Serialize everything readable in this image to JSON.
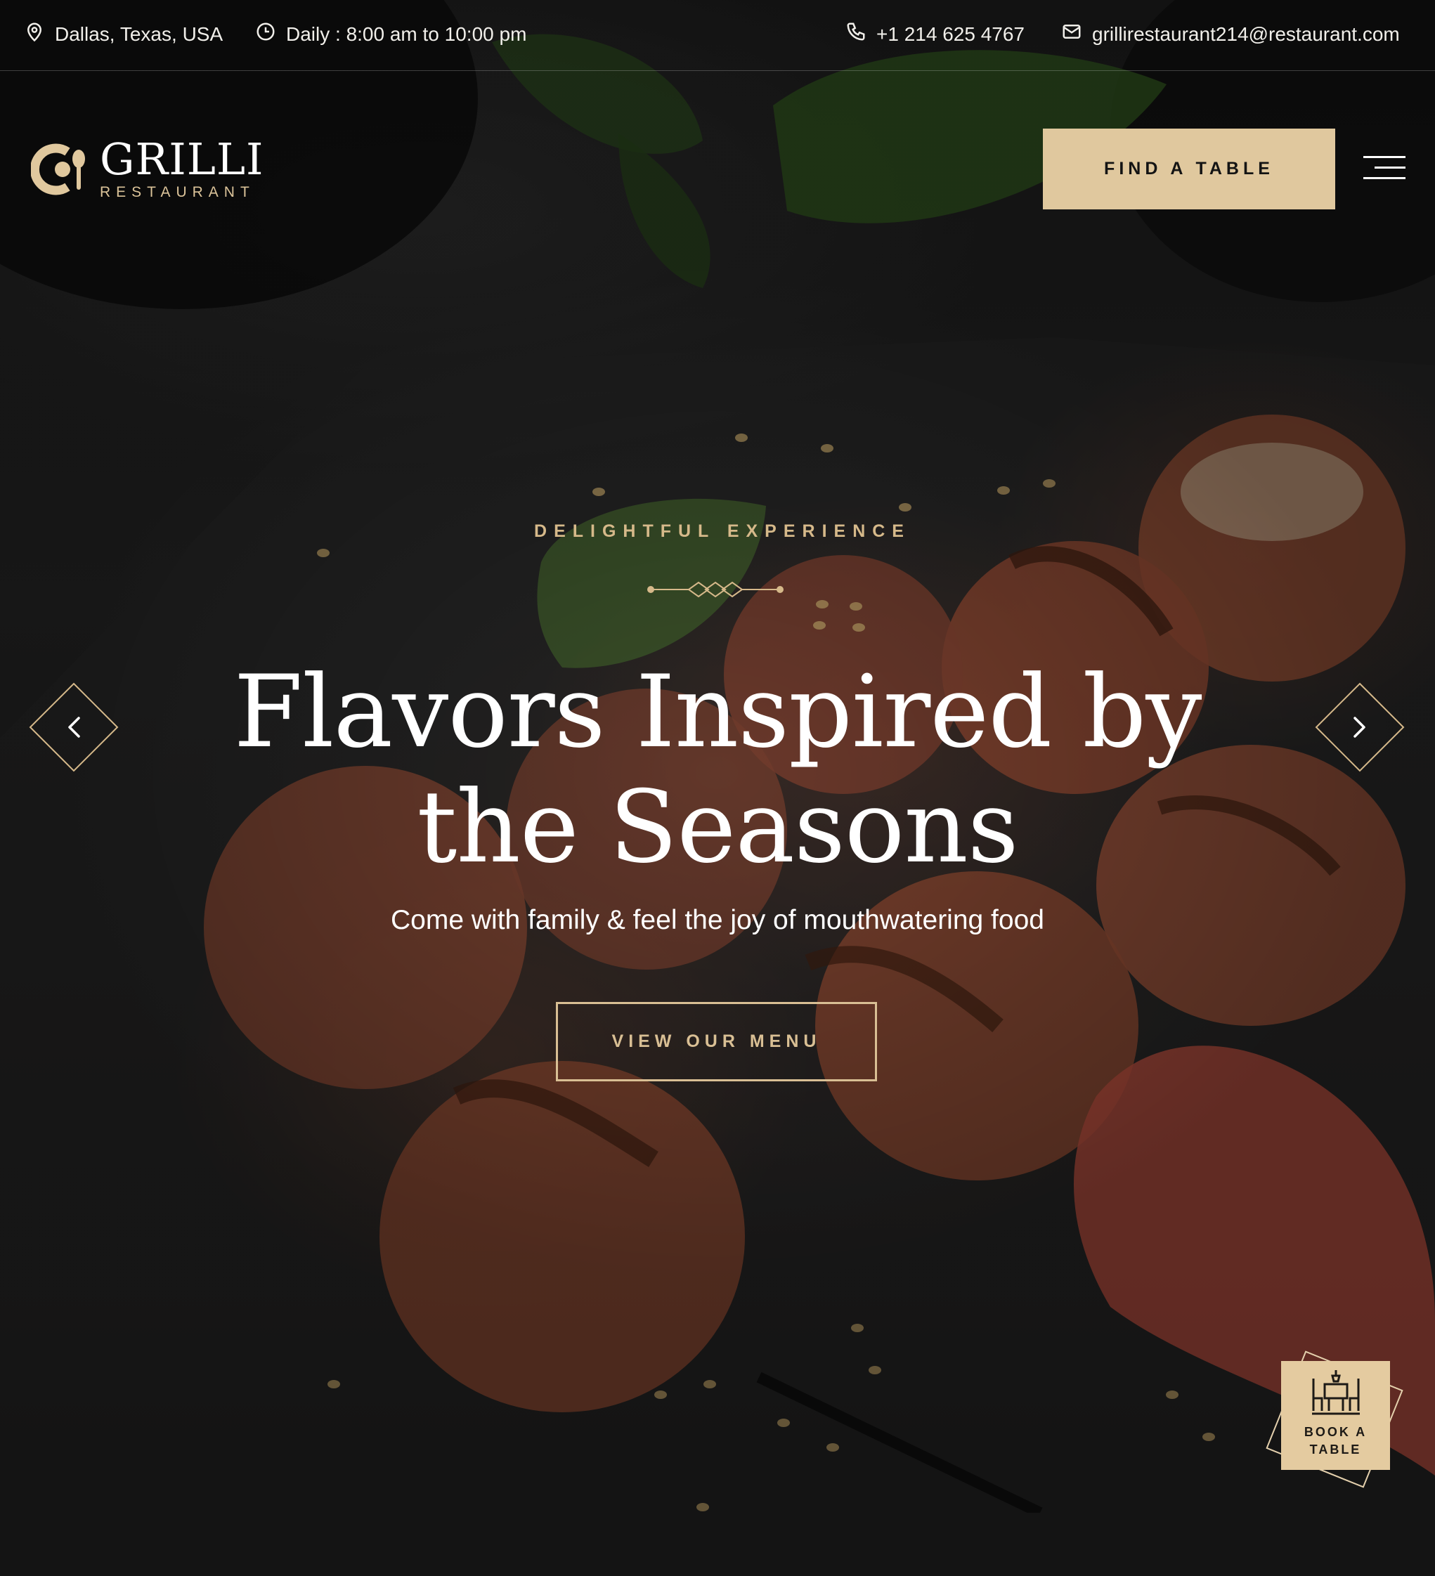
{
  "topbar": {
    "location": "Dallas, Texas, USA",
    "hours": "Daily : 8:00 am to 10:00 pm",
    "phone": "+1 214 625 4767",
    "email": "grillirestaurant214@restaurant.com",
    "icons": [
      "location-pin-icon",
      "clock-icon",
      "phone-icon",
      "mail-icon"
    ]
  },
  "header": {
    "logo_name": "GRILLI",
    "logo_sub": "RESTAURANT",
    "find_table_label": "FIND A TABLE"
  },
  "hero": {
    "eyebrow": "DELIGHTFUL EXPERIENCE",
    "headline_line1": "Flavors Inspired by",
    "headline_line2": "the Seasons",
    "subline": "Come with family & feel the joy of mouthwatering food",
    "cta_label": "VIEW OUR MENU"
  },
  "book_table": {
    "label_line1": "BOOK A",
    "label_line2": "TABLE"
  },
  "colors": {
    "accent": "#e0c89e",
    "accent_text": "#d6b98a",
    "background": "#141414",
    "text": "#ffffff"
  }
}
